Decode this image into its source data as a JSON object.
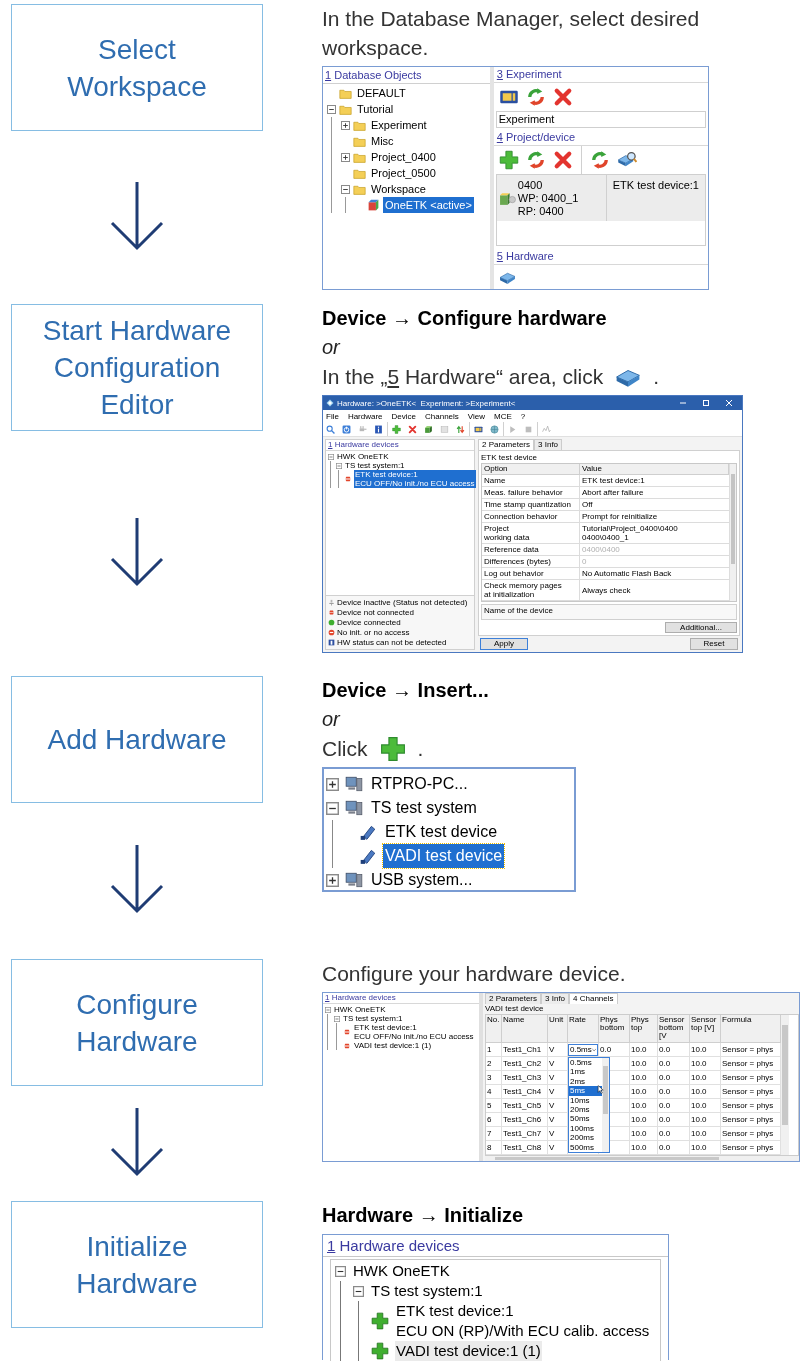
{
  "steps": [
    {
      "label": "Select Workspace",
      "instructions": [
        {
          "kind": "plain",
          "parts": [
            {
              "text": "In the Database Manager, select desired workspace.",
              "underline": false
            }
          ]
        }
      ],
      "screenshot": {
        "kind": "database_manager",
        "objects_panel": {
          "accel": "1",
          "title": "Database Objects",
          "tree": [
            {
              "label": "DEFAULT",
              "kind": "folder",
              "selected": false
            },
            {
              "label": "Tutorial",
              "kind": "folder",
              "expanded": true,
              "selected": false,
              "children": [
                {
                  "label": "Experiment",
                  "kind": "folder",
                  "expanded": false,
                  "selected": false
                },
                {
                  "label": "Misc",
                  "kind": "folder",
                  "selected": false
                },
                {
                  "label": "Project_0400",
                  "kind": "folder",
                  "expanded": false,
                  "selected": false
                },
                {
                  "label": "Project_0500",
                  "kind": "folder",
                  "selected": false
                },
                {
                  "label": "Workspace",
                  "kind": "folder",
                  "expanded": true,
                  "selected": false,
                  "children": [
                    {
                      "label": "OneETK <active>",
                      "kind": "workspace",
                      "selected": true
                    }
                  ]
                }
              ]
            }
          ]
        },
        "sections": [
          {
            "accel": "3",
            "title": "Experiment",
            "field": "Experiment"
          },
          {
            "accel": "4",
            "title": "Project/device",
            "entry": {
              "lines": [
                "0400",
                "WP: 0400_1",
                "RP: 0400"
              ],
              "device": "ETK test device:1"
            }
          },
          {
            "accel": "5",
            "title": "Hardware"
          }
        ]
      }
    },
    {
      "label": "Start Hardware Configuration Editor",
      "instructions": [
        {
          "kind": "menu",
          "parts": [
            {
              "text": "Device → Configure hardware",
              "underline": false
            }
          ]
        },
        {
          "kind": "alternative",
          "parts": [
            {
              "text": "or",
              "underline": false
            }
          ]
        },
        {
          "kind": "plain",
          "parts": [
            {
              "text": "In the „",
              "underline": false
            },
            {
              "text": "5",
              "underline": true
            },
            {
              "text": " Hardware“ area, click",
              "underline": false
            }
          ],
          "tail": "."
        }
      ],
      "screenshot": {
        "kind": "hardware_editor",
        "title": "Hardware: >OneETK<  Experiment: >Experiment<",
        "menu": [
          "File",
          "Hardware",
          "Device",
          "Channels",
          "View",
          "MCE",
          "?"
        ],
        "devices_panel": {
          "accel": "1",
          "title": "Hardware devices",
          "tree": [
            {
              "label": "HWK OneETK",
              "expanded": true,
              "selected": false,
              "children": [
                {
                  "label": "TS test system:1",
                  "expanded": true,
                  "selected": false,
                  "children": [
                    {
                      "label": "ETK test device:1",
                      "sublabel": "ECU OFF/No init./no ECU access",
                      "kind": "device_not_connected",
                      "selected": true
                    }
                  ]
                }
              ]
            }
          ]
        },
        "legend": [
          {
            "kind": "inactive",
            "text": "Device inactive (Status not detected)"
          },
          {
            "kind": "not_connected",
            "text": "Device not connected"
          },
          {
            "kind": "connected",
            "text": "Device connected"
          },
          {
            "kind": "no_access",
            "text": "No init. or no access"
          },
          {
            "kind": "undetectable",
            "text": "HW status can not be detected"
          }
        ],
        "tabs": [
          {
            "label": "2 Parameters",
            "selected": true
          },
          {
            "label": "3 Info",
            "selected": false
          }
        ],
        "heading": "ETK test device",
        "columns": [
          "Option",
          "Value"
        ],
        "rows": [
          {
            "option": "Name",
            "value": "ETK test device:1",
            "disabled": false
          },
          {
            "option": "Meas. failure behavior",
            "value": "Abort after failure",
            "disabled": false
          },
          {
            "option": "Time stamp quantization",
            "value": "Off",
            "disabled": false
          },
          {
            "option": "Connection behavior",
            "value": "Prompt for reinitialize",
            "disabled": false
          },
          {
            "option": "Project\nworking data",
            "value": "Tutorial\\Project_0400\\0400\n0400\\0400_1",
            "disabled": false
          },
          {
            "option": "Reference data",
            "value": "0400\\0400",
            "disabled": true
          },
          {
            "option": "Differences (bytes)",
            "value": "0",
            "disabled": true
          },
          {
            "option": "Log out behavior",
            "value": "No Automatic Flash Back",
            "disabled": false
          },
          {
            "option": "Check memory pages\nat initialization",
            "value": "Always check",
            "disabled": false
          }
        ],
        "description": "Name of the device",
        "additional_button": "Additional...",
        "apply_button": "Apply",
        "reset_button": "Reset"
      }
    },
    {
      "label": "Add Hardware",
      "instructions": [
        {
          "kind": "menu",
          "parts": [
            {
              "text": "Device → Insert...",
              "underline": false
            }
          ]
        },
        {
          "kind": "alternative",
          "parts": [
            {
              "text": "or",
              "underline": false
            }
          ]
        },
        {
          "kind": "plain",
          "parts": [
            {
              "text": "Click",
              "underline": false
            }
          ],
          "tail": "."
        }
      ],
      "screenshot": {
        "kind": "device_tree",
        "tree": [
          {
            "label": "RTPRO-PC...",
            "kind": "computer",
            "expanded": false,
            "selected": false
          },
          {
            "label": "TS test system",
            "kind": "computer",
            "expanded": true,
            "selected": false,
            "children": [
              {
                "label": "ETK test device",
                "kind": "probe",
                "selected": false
              },
              {
                "label": "VADI test device",
                "kind": "probe",
                "selected": true
              }
            ]
          },
          {
            "label": "USB system...",
            "kind": "computer",
            "expanded": false,
            "selected": false
          }
        ]
      }
    },
    {
      "label": "Configure Hardware",
      "instructions": [
        {
          "kind": "plain",
          "parts": [
            {
              "text": "Configure your hardware device.",
              "underline": false
            }
          ]
        }
      ],
      "screenshot": {
        "kind": "channel_editor",
        "devices_panel": {
          "accel": "1",
          "title": "Hardware devices",
          "tree": [
            {
              "label": "HWK OneETK",
              "expanded": true,
              "selected": false,
              "children": [
                {
                  "label": "TS test system:1",
                  "expanded": true,
                  "selected": false,
                  "children": [
                    {
                      "label": "ETK test device:1",
                      "sublabel": "ECU OFF/No init./no ECU access",
                      "kind": "device_not_connected",
                      "selected": false
                    },
                    {
                      "label": "VADI test device:1 (1)",
                      "kind": "device_not_connected",
                      "selected": false
                    }
                  ]
                }
              ]
            }
          ]
        },
        "tabs": [
          {
            "label": "2 Parameters",
            "selected": false
          },
          {
            "label": "3 Info",
            "selected": false
          },
          {
            "label": "4 Channels",
            "selected": true
          }
        ],
        "heading": "VADI test device",
        "columns": [
          "No.",
          "Name",
          "Unit",
          "Rate",
          "Phys bottom",
          "Phys top",
          "Sensor bottom [V",
          "Sensor top [V]",
          "Formula"
        ],
        "rows": [
          [
            "1",
            "Test1_Ch1",
            "V",
            "0.5ms",
            "0.0",
            "10.0",
            "0.0",
            "10.0",
            "Sensor = phys"
          ],
          [
            "2",
            "Test1_Ch2",
            "V",
            null,
            null,
            "10.0",
            "0.0",
            "10.0",
            "Sensor = phys"
          ],
          [
            "3",
            "Test1_Ch3",
            "V",
            null,
            null,
            "10.0",
            "0.0",
            "10.0",
            "Sensor = phys"
          ],
          [
            "4",
            "Test1_Ch4",
            "V",
            null,
            null,
            "10.0",
            "0.0",
            "10.0",
            "Sensor = phys"
          ],
          [
            "5",
            "Test1_Ch5",
            "V",
            null,
            null,
            "10.0",
            "0.0",
            "10.0",
            "Sensor = phys"
          ],
          [
            "6",
            "Test1_Ch6",
            "V",
            null,
            null,
            "10.0",
            "0.0",
            "10.0",
            "Sensor = phys"
          ],
          [
            "7",
            "Test1_Ch7",
            "V",
            null,
            null,
            "10.0",
            "0.0",
            "10.0",
            "Sensor = phys"
          ],
          [
            "8",
            "Test1_Ch8",
            "V",
            null,
            null,
            "10.0",
            "0.0",
            "10.0",
            "Sensor = phys"
          ]
        ],
        "rate_options": [
          {
            "label": "0.5ms",
            "selected": false
          },
          {
            "label": "1ms",
            "selected": false
          },
          {
            "label": "2ms",
            "selected": false
          },
          {
            "label": "5ms",
            "selected": true
          },
          {
            "label": "10ms",
            "selected": false
          },
          {
            "label": "20ms",
            "selected": false
          },
          {
            "label": "50ms",
            "selected": false
          },
          {
            "label": "100ms",
            "selected": false
          },
          {
            "label": "200ms",
            "selected": false
          },
          {
            "label": "500ms",
            "selected": false
          }
        ]
      }
    },
    {
      "label": "Initialize Hardware",
      "instructions": [
        {
          "kind": "menu",
          "parts": [
            {
              "text": "Hardware →  Initialize",
              "underline": false
            }
          ]
        }
      ],
      "screenshot": {
        "kind": "device_panel",
        "accel": "1",
        "title": "Hardware devices",
        "tree": [
          {
            "label": "HWK OneETK",
            "expanded": true,
            "selected": false,
            "children": [
              {
                "label": "TS test system:1",
                "expanded": true,
                "selected": false,
                "children": [
                  {
                    "label": "ETK test device:1",
                    "sublabel": "ECU ON (RP)/With ECU calib. access",
                    "kind": "device_connected",
                    "selected": false
                  },
                  {
                    "label": "VADI test device:1 (1)",
                    "kind": "device_connected",
                    "selected": true
                  }
                ]
              }
            ]
          }
        ]
      }
    }
  ]
}
